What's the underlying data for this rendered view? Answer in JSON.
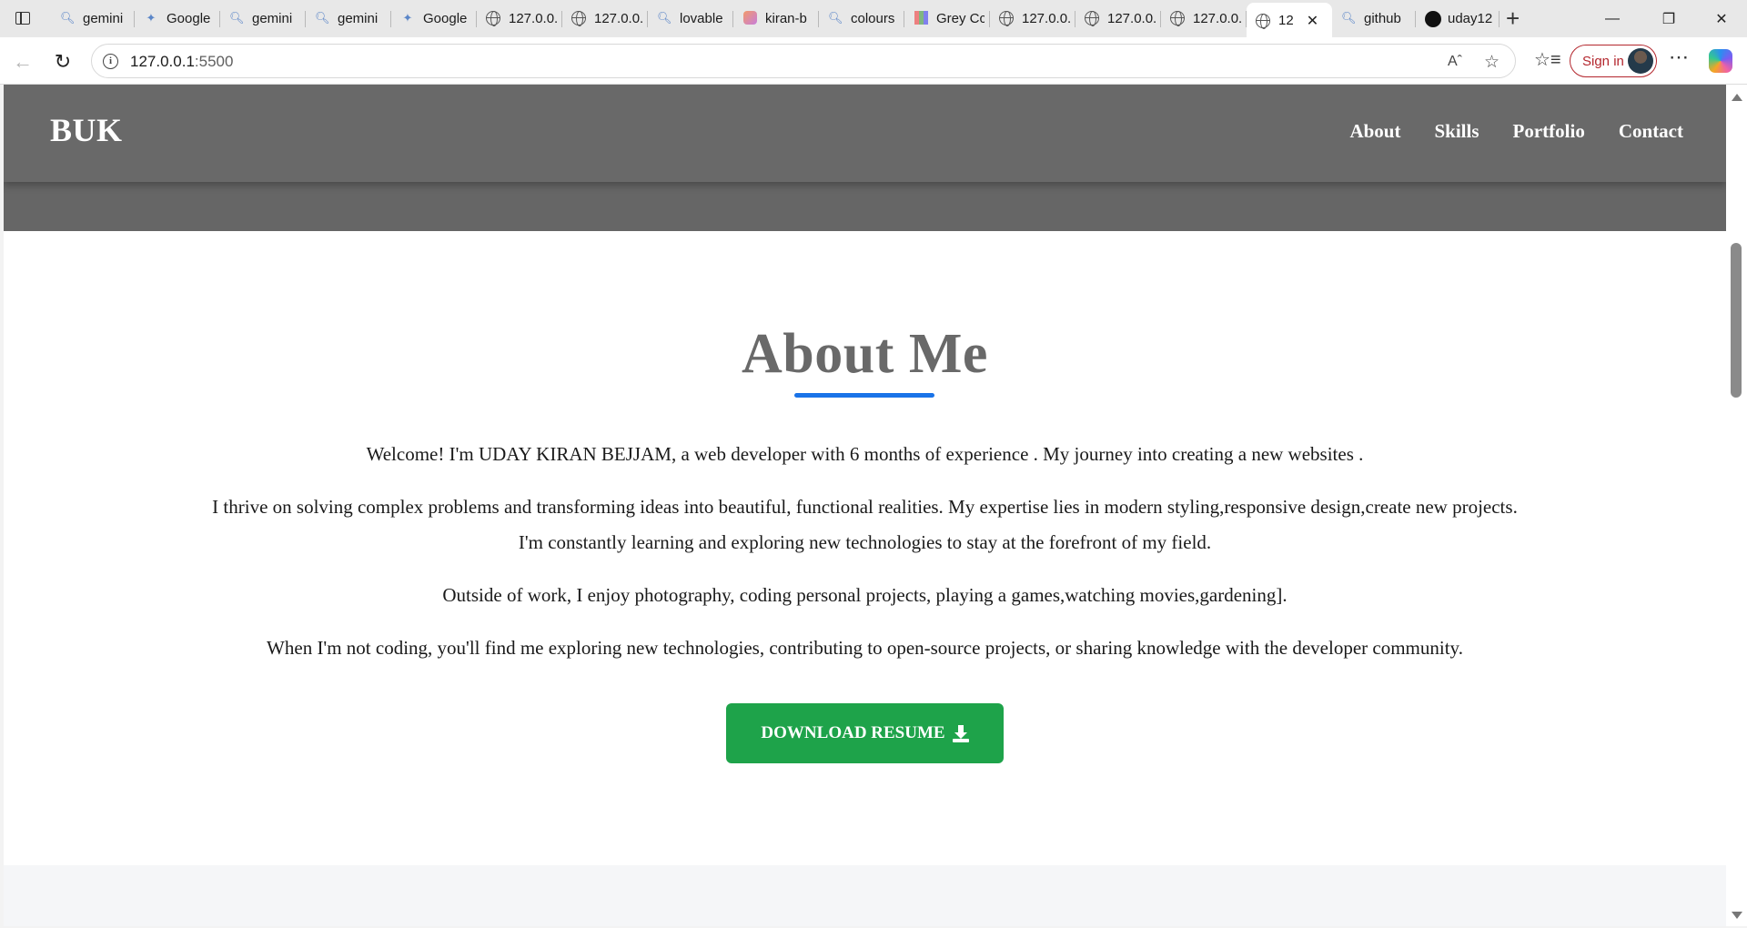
{
  "browser": {
    "tabs": [
      {
        "title": "gemini",
        "icon": "search-icon"
      },
      {
        "title": "Google",
        "icon": "gemini-sparkle-icon"
      },
      {
        "title": "gemini",
        "icon": "search-icon"
      },
      {
        "title": "gemini",
        "icon": "search-icon"
      },
      {
        "title": "Google",
        "icon": "gemini-sparkle-icon"
      },
      {
        "title": "127.0.0.",
        "icon": "globe-icon"
      },
      {
        "title": "127.0.0.",
        "icon": "globe-icon"
      },
      {
        "title": "lovable",
        "icon": "search-icon"
      },
      {
        "title": "kiran-b",
        "icon": "lovable-icon"
      },
      {
        "title": "colours",
        "icon": "search-icon"
      },
      {
        "title": "Grey Cc",
        "icon": "palette-icon"
      },
      {
        "title": "127.0.0.",
        "icon": "globe-icon"
      },
      {
        "title": "127.0.0.",
        "icon": "globe-icon"
      },
      {
        "title": "127.0.0.",
        "icon": "globe-icon"
      },
      {
        "title": "12",
        "icon": "globe-icon",
        "active": true
      },
      {
        "title": "github",
        "icon": "search-icon"
      },
      {
        "title": "uday12",
        "icon": "github-icon"
      }
    ],
    "url_host": "127.0.0.1",
    "url_port": ":5500",
    "signin_label": "Sign in"
  },
  "site": {
    "logo": "BUK",
    "nav": [
      "About",
      "Skills",
      "Portfolio",
      "Contact"
    ],
    "header_color": "#696969"
  },
  "about": {
    "title": "About Me",
    "paragraphs": [
      "Welcome! I'm UDAY KIRAN BEJJAM, a web developer with 6 months of experience . My journey into creating a new websites .",
      "I thrive on solving complex problems and transforming ideas into beautiful, functional realities. My expertise lies in modern styling,responsive design,create new projects. I'm constantly learning and exploring new technologies to stay at the forefront of my field.",
      "Outside of work, I enjoy photography, coding personal projects, playing a games,watching movies,gardening].",
      "When I'm not coding, you'll find me exploring new technologies, contributing to open-source projects, or sharing knowledge with the developer community."
    ],
    "resume_button": "DOWNLOAD RESUME",
    "accent_color": "#1a73e8",
    "button_color": "#1ea34a"
  }
}
